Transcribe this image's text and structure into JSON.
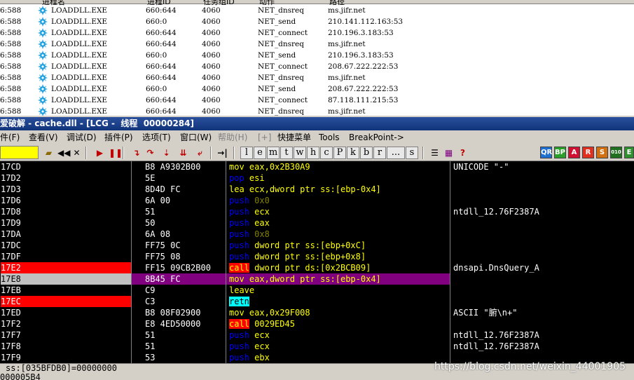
{
  "monitor": {
    "columns": [
      "进程名",
      "进程ID",
      "任务组ID",
      "动作",
      "路径"
    ],
    "rows": [
      {
        "time": "6:588",
        "process": "LOADDLL.EXE",
        "pid": "660:644",
        "tid": "4060",
        "action": "NET_dnsreq",
        "path": "ms.jifr.net"
      },
      {
        "time": "6:588",
        "process": "LOADDLL.EXE",
        "pid": "660:0",
        "tid": "4060",
        "action": "NET_send",
        "path": "210.141.112.163:53"
      },
      {
        "time": "6:588",
        "process": "LOADDLL.EXE",
        "pid": "660:644",
        "tid": "4060",
        "action": "NET_connect",
        "path": "210.196.3.183:53"
      },
      {
        "time": "6:588",
        "process": "LOADDLL.EXE",
        "pid": "660:644",
        "tid": "4060",
        "action": "NET_dnsreq",
        "path": "ms.jifr.net"
      },
      {
        "time": "6:588",
        "process": "LOADDLL.EXE",
        "pid": "660:0",
        "tid": "4060",
        "action": "NET_send",
        "path": "210.196.3.183:53"
      },
      {
        "time": "6:588",
        "process": "LOADDLL.EXE",
        "pid": "660:644",
        "tid": "4060",
        "action": "NET_connect",
        "path": "208.67.222.222:53"
      },
      {
        "time": "6:588",
        "process": "LOADDLL.EXE",
        "pid": "660:644",
        "tid": "4060",
        "action": "NET_dnsreq",
        "path": "ms.jifr.net"
      },
      {
        "time": "6:588",
        "process": "LOADDLL.EXE",
        "pid": "660:0",
        "tid": "4060",
        "action": "NET_send",
        "path": "208.67.222.222:53"
      },
      {
        "time": "6:588",
        "process": "LOADDLL.EXE",
        "pid": "660:644",
        "tid": "4060",
        "action": "NET_connect",
        "path": "87.118.111.215:53"
      },
      {
        "time": "6:588",
        "process": "LOADDLL.EXE",
        "pid": "660:644",
        "tid": "4060",
        "action": "NET_dnsreq",
        "path": "ms.jifr.net"
      }
    ]
  },
  "window": {
    "title": "爱破解 - cache.dll - [LCG -  线程  00000284]"
  },
  "menu": [
    "件(F)",
    "查看(V)",
    "调试(D)",
    "插件(P)",
    "选项(T)",
    "窗口(W)",
    "帮助(H)",
    "[+]",
    "快捷菜单",
    "Tools",
    "BreakPoint->"
  ],
  "toolbar": {
    "letters": [
      "l",
      "e",
      "m",
      "t",
      "w",
      "h",
      "c",
      "P",
      "k",
      "b",
      "r",
      "...",
      "s"
    ],
    "right_icons": [
      "QR",
      "BP",
      "A",
      "R",
      "S",
      "010",
      "E"
    ]
  },
  "disasm": [
    {
      "addr": "17CD",
      "hex": "B8 A9302B00",
      "op": "mov",
      "args": "eax,0x2B30A9",
      "comment": "UNICODE \"-\"",
      "hl": ""
    },
    {
      "addr": "17D2",
      "hex": "5E",
      "op": "pop",
      "args": "esi",
      "comment": "",
      "hl": ""
    },
    {
      "addr": "17D3",
      "hex": "8D4D FC",
      "op": "lea",
      "args": "ecx,dword ptr ss:[ebp-0x4]",
      "comment": "",
      "hl": ""
    },
    {
      "addr": "17D6",
      "hex": "6A 00",
      "op": "push",
      "args": "0x0",
      "comment": "",
      "hl": ""
    },
    {
      "addr": "17D8",
      "hex": "51",
      "op": "push",
      "args": "ecx",
      "comment": "ntdll_12.76F2387A",
      "hl": ""
    },
    {
      "addr": "17D9",
      "hex": "50",
      "op": "push",
      "args": "eax",
      "comment": "",
      "hl": ""
    },
    {
      "addr": "17DA",
      "hex": "6A 08",
      "op": "push",
      "args": "0x8",
      "comment": "",
      "hl": ""
    },
    {
      "addr": "17DC",
      "hex": "FF75 0C",
      "op": "push",
      "args": "dword ptr ss:[ebp+0xC]",
      "comment": "",
      "hl": ""
    },
    {
      "addr": "17DF",
      "hex": "FF75 08",
      "op": "push",
      "args": "dword ptr ss:[ebp+0x8]",
      "comment": "",
      "hl": ""
    },
    {
      "addr": "17E2",
      "hex": "FF15 09CB2B00",
      "op": "call",
      "args": "dword ptr ds:[0x2BCB09]",
      "comment": "dnsapi.DnsQuery_A",
      "hl": "red"
    },
    {
      "addr": "17E8",
      "hex": "8B45 FC",
      "op": "mov",
      "args": "eax,dword ptr ss:[ebp-0x4]",
      "comment": "",
      "hl": "current"
    },
    {
      "addr": "17EB",
      "hex": "C9",
      "op": "leave",
      "args": "",
      "comment": "",
      "hl": ""
    },
    {
      "addr": "17EC",
      "hex": "C3",
      "op": "retn",
      "args": "",
      "comment": "",
      "hl": "red"
    },
    {
      "addr": "17ED",
      "hex": "B8 08F02900",
      "op": "mov",
      "args": "eax,0x29F008",
      "comment": "ASCII \"腑\\n+\"",
      "hl": ""
    },
    {
      "addr": "17F2",
      "hex": "E8 4ED50000",
      "op": "call",
      "args": "0029ED45",
      "comment": "",
      "hl": ""
    },
    {
      "addr": "17F7",
      "hex": "51",
      "op": "push",
      "args": "ecx",
      "comment": "ntdll_12.76F2387A",
      "hl": ""
    },
    {
      "addr": "17F8",
      "hex": "51",
      "op": "push",
      "args": "ecx",
      "comment": "ntdll_12.76F2387A",
      "hl": ""
    },
    {
      "addr": "17F9",
      "hex": "53",
      "op": "push",
      "args": "ebx",
      "comment": "",
      "hl": ""
    }
  ],
  "info": {
    "line1": "ss:[035BFDB0]=00000000",
    "line2": "000005B4"
  },
  "watermark": "https://blog.csdn.net/weixin_44001905",
  "colors": {
    "breakpoint": "#ff0000",
    "current_line": "#800080",
    "asm_keyword": "#ffff00",
    "push_keyword": "#0000ff",
    "retn_bg": "#00ffff"
  }
}
